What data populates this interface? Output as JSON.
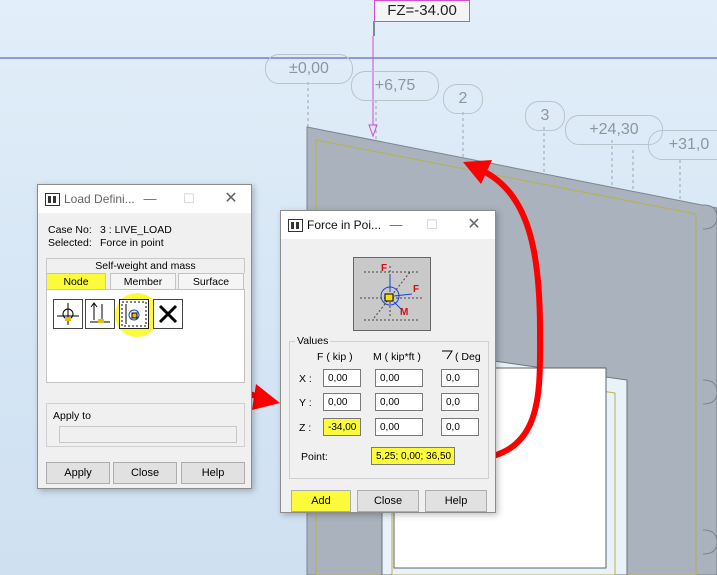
{
  "viewport": {
    "fz_label": "FZ=-34.00",
    "grid_labels": [
      "±0,00",
      "+6,75",
      "2",
      "3",
      "+24,30",
      "+31,0"
    ]
  },
  "load_dialog": {
    "title": "Load Defini...",
    "case_label": "Case No:",
    "case_value": "3 : LIVE_LOAD",
    "selected_label": "Selected:",
    "selected_value": "Force in point",
    "group_title": "Self-weight and mass",
    "tabs": [
      "Node",
      "Member",
      "Surface"
    ],
    "apply_to_label": "Apply to",
    "buttons": {
      "apply": "Apply",
      "close": "Close",
      "help": "Help"
    }
  },
  "force_dialog": {
    "title": "Force in Poi...",
    "values_group": "Values",
    "col_f": "F  ( kip )",
    "col_m": "M  ( kip*ft )",
    "col_deg": "( Deg",
    "rows": [
      {
        "label": "X :",
        "f": "0,00",
        "m": "0,00",
        "deg": "0,0"
      },
      {
        "label": "Y :",
        "f": "0,00",
        "m": "0,00",
        "deg": "0,0"
      },
      {
        "label": "Z :",
        "f": "-34,00",
        "m": "0,00",
        "deg": "0,0"
      }
    ],
    "point_label": "Point:",
    "point_value": "5,25; 0,00; 36,50",
    "buttons": {
      "add": "Add",
      "close": "Close",
      "help": "Help"
    },
    "diagram_labels": {
      "f_top": "F",
      "f_right": "F",
      "m": "M"
    }
  },
  "colors": {
    "highlight": "#fbfb3b",
    "annotation": "#ff0000",
    "load_arrow": "#d04ed0"
  }
}
